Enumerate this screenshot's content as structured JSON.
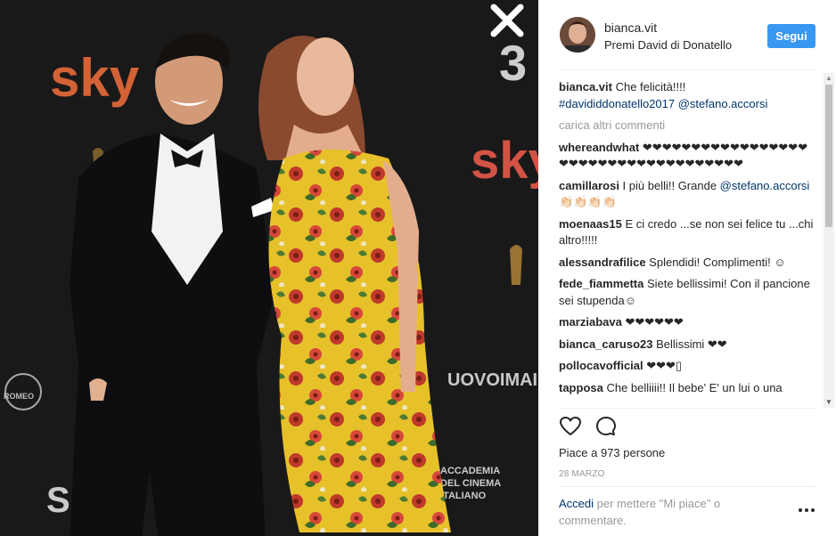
{
  "post": {
    "username": "bianca.vit",
    "location": "Premi David di Donatello",
    "follow_label": "Segui",
    "caption_text": "Che felicità!!!!",
    "caption_tags": "#davididdonatello2017 @stefano.accorsi",
    "load_more": "carica altri commenti",
    "likes": "Piace a 973 persone",
    "date": "28 MARZO",
    "login_link": "Accedi",
    "login_text": " per mettere \"Mi piace\" o commentare."
  },
  "comments": [
    {
      "user": "whereandwhat",
      "text": " ❤❤❤❤❤❤❤❤❤❤❤❤❤❤❤❤❤❤❤❤❤❤❤❤❤❤❤❤❤❤❤❤❤❤❤❤",
      "mention": ""
    },
    {
      "user": "camillarosi",
      "text": " I più belli!! Grande ",
      "mention": "@stefano.accorsi",
      "after": " 👏🏻👏🏻👏🏻👏🏻"
    },
    {
      "user": "moenaas15",
      "text": " E ci credo ...se non sei felice tu ...chi altro!!!!!",
      "mention": ""
    },
    {
      "user": "alessandrafilice",
      "text": " Splendidi! Complimenti! ☺",
      "mention": ""
    },
    {
      "user": "fede_fiammetta",
      "text": " Siete bellissimi! Con il pancione sei stupenda☺",
      "mention": ""
    },
    {
      "user": "marziabava",
      "text": " ❤❤❤❤❤❤",
      "mention": ""
    },
    {
      "user": "bianca_caruso23",
      "text": " Bellissimi ❤❤",
      "mention": ""
    },
    {
      "user": "pollocavofficial",
      "text": " ❤❤❤▯",
      "mention": ""
    },
    {
      "user": "tapposa",
      "text": " Che belliiii!! Il bebe' E' un lui o una",
      "mention": ""
    }
  ],
  "photo": {
    "backdrop_texts": [
      "sky",
      "sky",
      "3",
      "SIAE",
      "UOVOIMAIE",
      "ACCADEMIA DEL CINEMA ITALIANO",
      "ROMEO"
    ]
  },
  "icons": {
    "close": "close-icon",
    "like": "heart-icon",
    "comment": "comment-icon",
    "more": "more-options-icon"
  },
  "colors": {
    "follow": "#3897f0",
    "link": "#003569",
    "dress": "#e8c52a"
  }
}
